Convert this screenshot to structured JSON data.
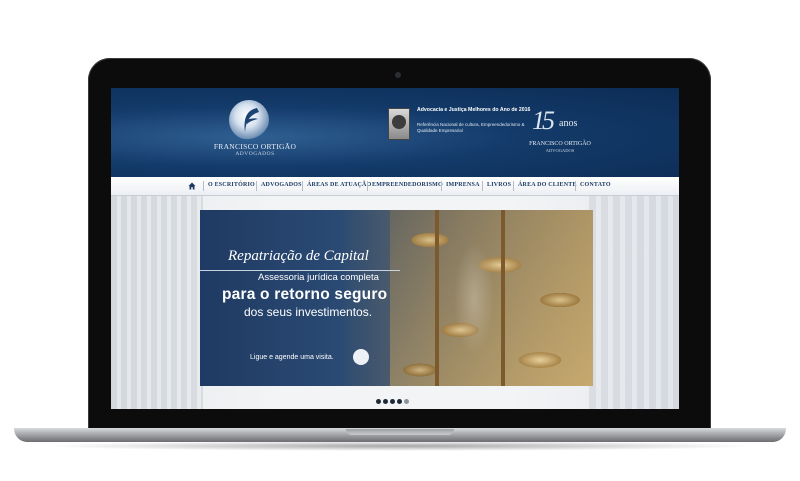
{
  "header": {
    "brand_name": "FRANCISCO ORTIGÃO",
    "brand_sub": "ADVOGADOS",
    "award_title": "Advocacia e Justiça Melhores do Ano de 2016",
    "award_desc": "Referência Nacional de cultura, Empreendedorismo & Qualidade Empresarial",
    "anniversary_number": "15",
    "anniversary_label": "anos",
    "anniversary_brand": "FRANCISCO ORTIGÃO",
    "anniversary_sub": "ADVOGADOS"
  },
  "nav": {
    "items": [
      {
        "label": "O ESCRITÓRIO"
      },
      {
        "label": "ADVOGADOS"
      },
      {
        "label": "ÁREAS DE ATUAÇÃO"
      },
      {
        "label": "EMPREENDEDORISMO"
      },
      {
        "label": "IMPRENSA"
      },
      {
        "label": "LIVROS"
      },
      {
        "label": "ÁREA DO CLIENTE"
      },
      {
        "label": "CONTATO"
      }
    ]
  },
  "banner": {
    "title": "Repatriação de Capital",
    "subtitle": "Assessoria jurídica completa",
    "headline": "para o retorno seguro",
    "headline2": "dos seus investimentos.",
    "cta": "Ligue e agende uma visita."
  },
  "slider": {
    "dot_count": 5,
    "active_index": 4
  },
  "colors": {
    "header_blue": "#133a69",
    "nav_text": "#1b3a63"
  }
}
